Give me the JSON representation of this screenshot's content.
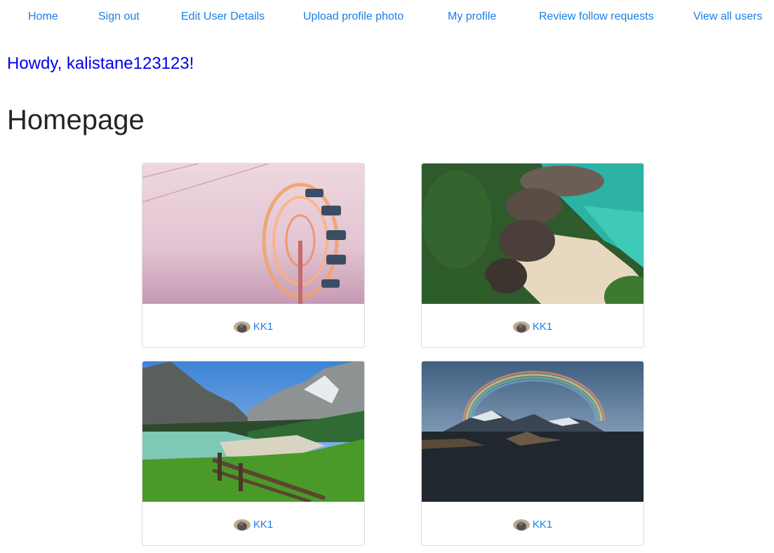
{
  "nav": {
    "items": [
      {
        "label": "Home"
      },
      {
        "label": "Sign out"
      },
      {
        "label": "Edit User Details"
      },
      {
        "label": "Upload profile photo"
      },
      {
        "label": "My profile"
      },
      {
        "label": "Review follow requests"
      },
      {
        "label": "View all users"
      }
    ]
  },
  "greeting": "Howdy, kalistane123123!",
  "page_title": "Homepage",
  "posts": [
    {
      "author": "KK1",
      "photo": "ferris-wheel-photo"
    },
    {
      "author": "KK1",
      "photo": "rocky-beach-photo"
    },
    {
      "author": "KK1",
      "photo": "mountain-lake-photo"
    },
    {
      "author": "KK1",
      "photo": "rainbow-mountain-photo"
    }
  ],
  "colors": {
    "link": "#1a7fe6",
    "greeting": "#0000ee",
    "card_border": "#dcdcdc"
  }
}
